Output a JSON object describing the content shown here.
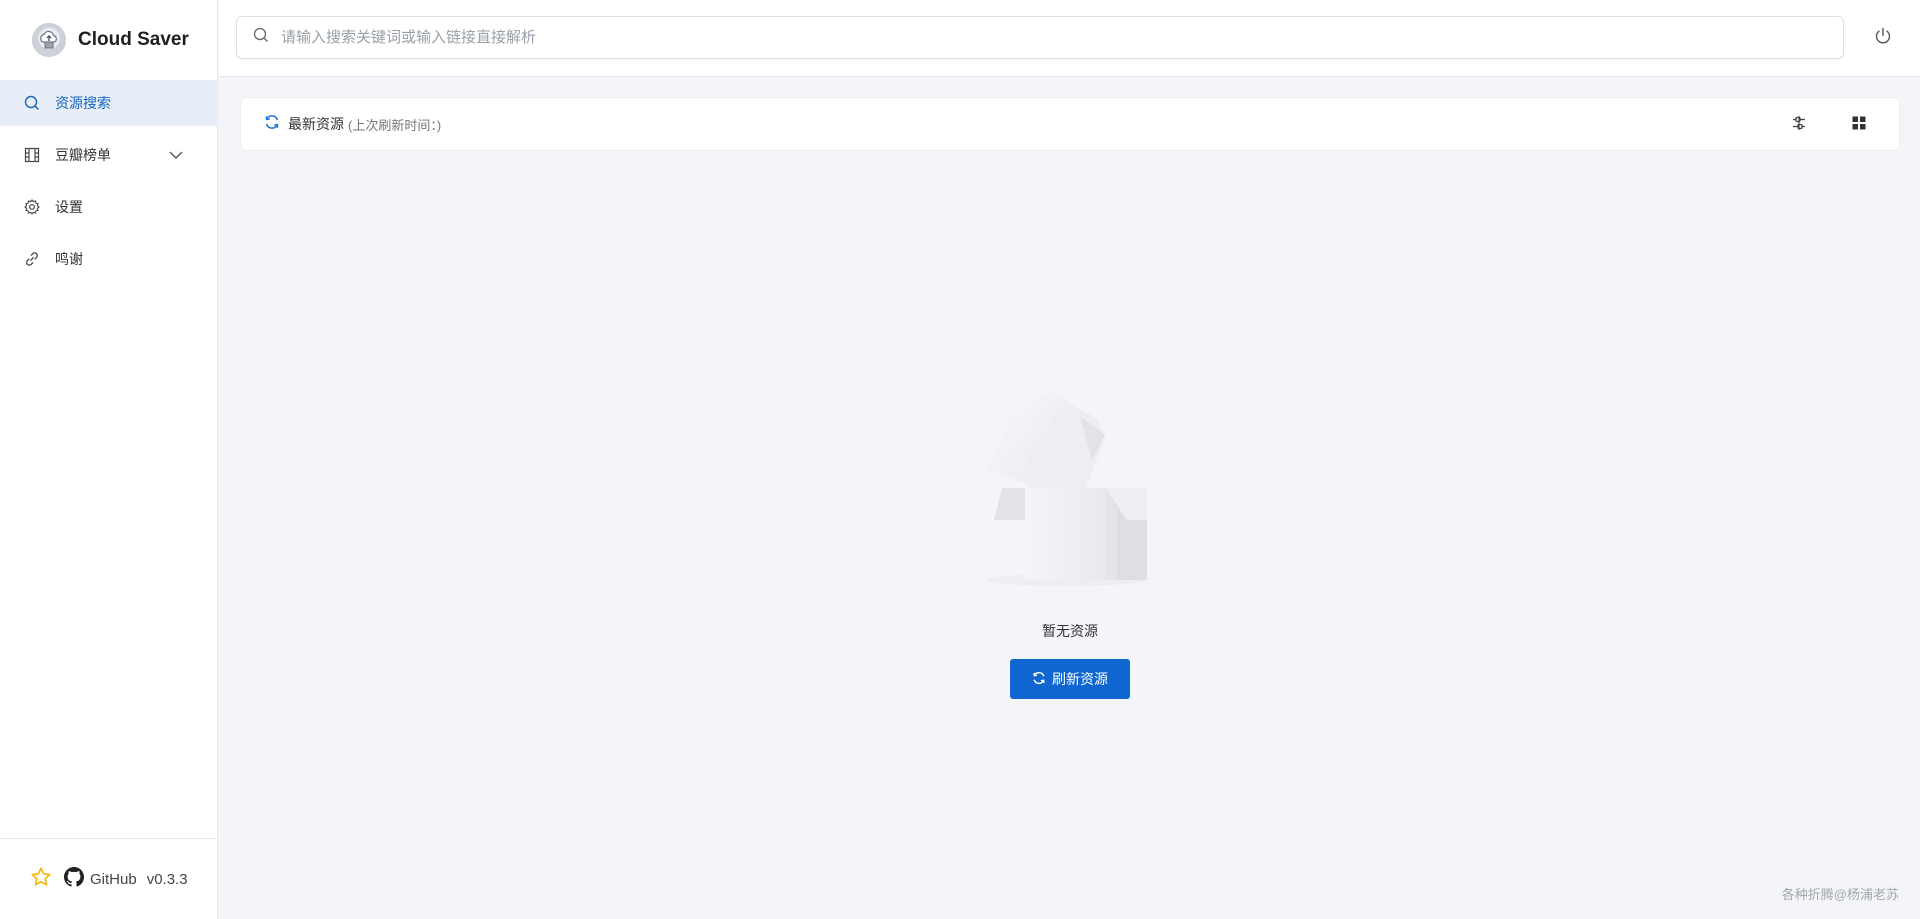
{
  "app": {
    "title": "Cloud Saver"
  },
  "sidebar": {
    "items": [
      {
        "label": "资源搜索",
        "icon": "search-icon",
        "active": true
      },
      {
        "label": "豆瓣榜单",
        "icon": "film-icon",
        "expandable": true
      },
      {
        "label": "设置",
        "icon": "gear-icon"
      },
      {
        "label": "鸣谢",
        "icon": "link-icon"
      }
    ],
    "footer": {
      "github_label": "GitHub",
      "version": "v0.3.3"
    }
  },
  "search": {
    "placeholder": "请输入搜索关键词或输入链接直接解析",
    "value": ""
  },
  "resources": {
    "title": "最新资源",
    "subtitle": "(上次刷新时间：)"
  },
  "empty_state": {
    "message": "暂无资源",
    "button_label": "刷新资源"
  },
  "watermark": "各种折腾@杨浦老苏",
  "colors": {
    "accent": "#0f66d0",
    "active_bg": "#e8eef7",
    "star": "#f5b80a"
  }
}
